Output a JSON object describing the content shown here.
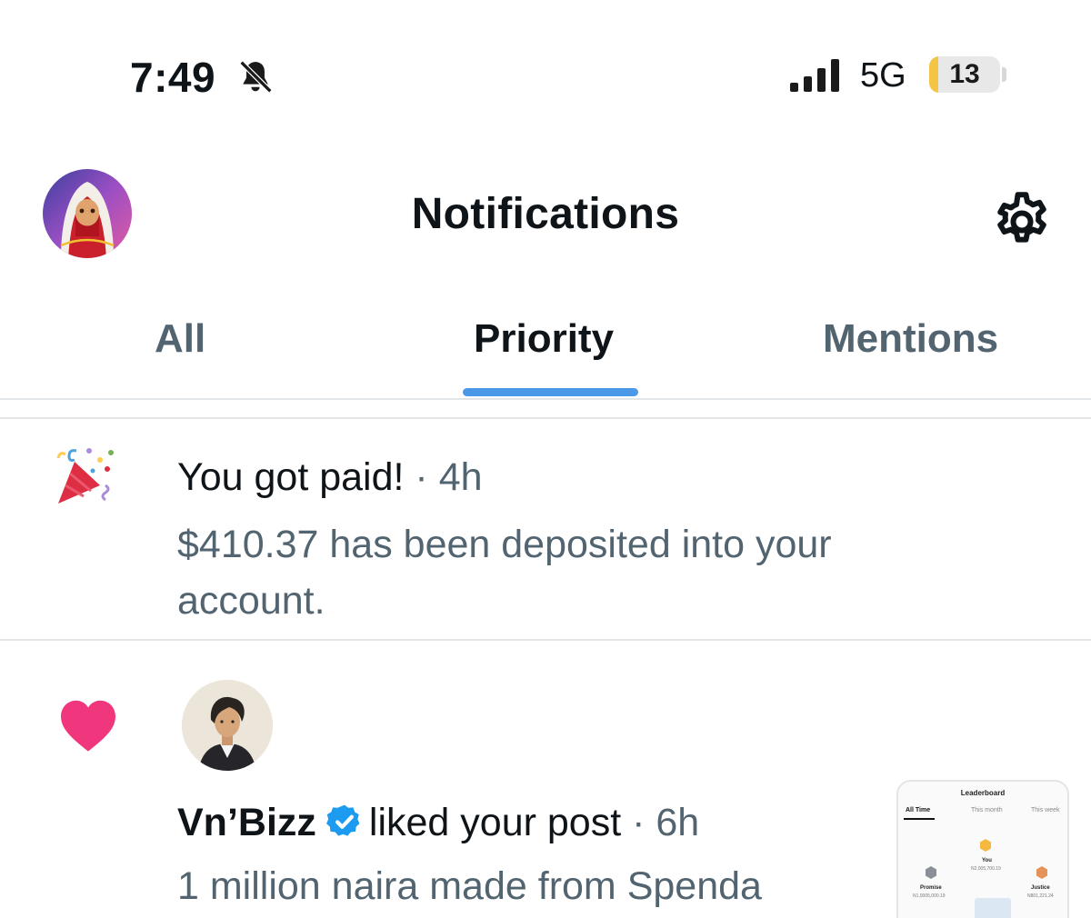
{
  "status_bar": {
    "time": "7:49",
    "network": "5G",
    "battery": "13",
    "battery_level": 0.13,
    "icons": [
      "bell-off-icon",
      "signal-icon",
      "battery-icon"
    ]
  },
  "header": {
    "title": "Notifications",
    "icons": [
      "avatar",
      "gear-icon"
    ]
  },
  "tabs": [
    {
      "label": "All",
      "active": false
    },
    {
      "label": "Priority",
      "active": true
    },
    {
      "label": "Mentions",
      "active": false
    }
  ],
  "colors": {
    "accent": "#4a99e9",
    "heart": "#f0367d",
    "verified": "#1d9bf0",
    "secondary_text": "#536471"
  },
  "notifications": [
    {
      "icon": "party-popper-icon",
      "title": "You got paid!",
      "separator": " · ",
      "time": "4h",
      "body_line1": "$410.37 has been deposited into your",
      "body_line2": "account."
    },
    {
      "icon": "heart-icon",
      "user": "Vn’Bizz",
      "verified": true,
      "action": "liked your post",
      "separator": " · ",
      "time": "6h",
      "post_preview": "1 million naira made from Spenda",
      "thumbnail": {
        "title": "Leaderboard",
        "tabs": [
          "All Time",
          "This month",
          "This week"
        ],
        "entries": [
          {
            "name": "You",
            "amount": "N2,005,700.19"
          },
          {
            "name": "Promise",
            "amount": "N1,0005,000.19"
          },
          {
            "name": "Justice",
            "amount": "N801,221.24"
          }
        ]
      }
    }
  ]
}
